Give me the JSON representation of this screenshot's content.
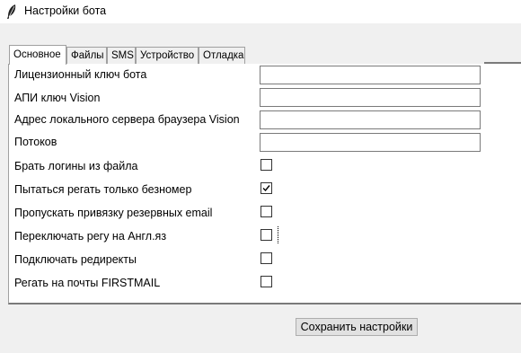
{
  "window": {
    "title": "Настройки бота",
    "icon": "feather-icon"
  },
  "tabs": [
    {
      "label": "Основное",
      "active": true
    },
    {
      "label": "Файлы",
      "active": false
    },
    {
      "label": "SMS",
      "active": false
    },
    {
      "label": "Устройство",
      "active": false
    },
    {
      "label": "Отладка",
      "active": false
    }
  ],
  "fields": [
    {
      "label": "Лицензионный ключ бота",
      "value": ""
    },
    {
      "label": "АПИ ключ Vision",
      "value": ""
    },
    {
      "label": "Адрес локального сервера браузера Vision",
      "value": ""
    },
    {
      "label": "Потоков",
      "value": ""
    }
  ],
  "options": [
    {
      "label": "Брать логины из файла",
      "checked": false
    },
    {
      "label": "Пытаться регать только безномер",
      "checked": true
    },
    {
      "label": "Пропускать привязку резервных email",
      "checked": false
    },
    {
      "label": "Переключать регу на Англ.яз",
      "checked": false
    },
    {
      "label": "Подключать редиректы",
      "checked": false
    },
    {
      "label": "Регать на почты FIRSTMAIL",
      "checked": false
    }
  ],
  "save_label": "Сохранить настройки"
}
